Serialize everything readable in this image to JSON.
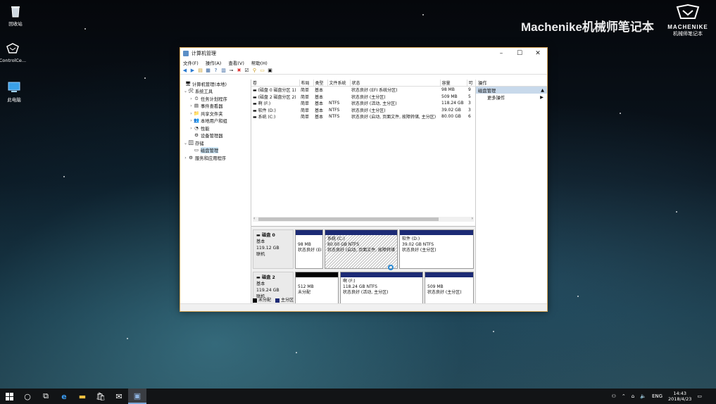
{
  "desktop": {
    "icons": [
      "回收站",
      "ControlCe...",
      "此电脑"
    ]
  },
  "watermark": {
    "text": "Machenike机械师笔记本",
    "brand_name": "MACHENIKE",
    "brand_sub": "机械师笔记本"
  },
  "window": {
    "title": "计算机管理",
    "min_glyph": "–",
    "max_glyph": "☐",
    "close_glyph": "✕",
    "menu": [
      "文件(F)",
      "操作(A)",
      "查看(V)",
      "帮助(H)"
    ],
    "tree": [
      {
        "label": "计算机管理(本地)",
        "arrow": "",
        "icon": "🖥"
      },
      {
        "label": "系统工具",
        "arrow": "⌄",
        "icon": "🛠"
      },
      {
        "label": "任务计划程序",
        "arrow": "›",
        "icon": "⏲"
      },
      {
        "label": "事件查看器",
        "arrow": "›",
        "icon": "▤"
      },
      {
        "label": "共享文件夹",
        "arrow": "›",
        "icon": "📁"
      },
      {
        "label": "本地用户和组",
        "arrow": "›",
        "icon": "👥"
      },
      {
        "label": "性能",
        "arrow": "›",
        "icon": "◔"
      },
      {
        "label": "设备管理器",
        "arrow": "",
        "icon": "⚙"
      },
      {
        "label": "存储",
        "arrow": "⌄",
        "icon": "🗄"
      },
      {
        "label": "磁盘管理",
        "arrow": "",
        "icon": "▭"
      },
      {
        "label": "服务和应用程序",
        "arrow": "›",
        "icon": "⚙"
      }
    ],
    "volume_columns": [
      "卷",
      "布局",
      "类型",
      "文件系统",
      "状态",
      "容量",
      "可"
    ],
    "volumes": [
      [
        "(磁盘 0 磁盘分区 1)",
        "简单",
        "基本",
        "",
        "状态良好 (EFI 系统分区)",
        "98 MB",
        "9"
      ],
      [
        "(磁盘 2 磁盘分区 2)",
        "简单",
        "基本",
        "",
        "状态良好 (主分区)",
        "509 MB",
        "5"
      ],
      [
        "啊 (F:)",
        "简单",
        "基本",
        "NTFS",
        "状态良好 (活动, 主分区)",
        "118.24 GB",
        "3"
      ],
      [
        "软件 (D:)",
        "简单",
        "基本",
        "NTFS",
        "状态良好 (主分区)",
        "39.02 GB",
        "3"
      ],
      [
        "系统 (C:)",
        "简单",
        "基本",
        "NTFS",
        "状态良好 (启动, 页面文件, 故障转储, 主分区)",
        "80.00 GB",
        "6"
      ]
    ],
    "disks": [
      {
        "name": "磁盘 0",
        "type": "基本",
        "size": "119.12 GB",
        "status": "联机",
        "partitions": [
          {
            "title": "",
            "size": "98 MB",
            "status": "状态良好 (EI"
          },
          {
            "title": "系统 (C:)",
            "size": "80.00 GB NTFS",
            "status": "状态良好 (启动, 页面文件, 故障转储"
          },
          {
            "title": "软件 (D:)",
            "size": "39.02 GB NTFS",
            "status": "状态良好 (主分区)"
          }
        ]
      },
      {
        "name": "磁盘 2",
        "type": "基本",
        "size": "119.24 GB",
        "status": "联机",
        "partitions": [
          {
            "title": "",
            "size": "512 MB",
            "status": "未分配"
          },
          {
            "title": "啊 (F:)",
            "size": "118.24 GB NTFS",
            "status": "状态良好 (活动, 主分区)"
          },
          {
            "title": "",
            "size": "509 MB",
            "status": "状态良好 (主分区)"
          }
        ]
      }
    ],
    "legend": [
      "未分配",
      "主分区"
    ],
    "actions": {
      "header": "操作",
      "section": "磁盘管理",
      "more": "更多操作"
    },
    "colors": {
      "primary_partition": "#1c2a75",
      "unallocated": "#000000",
      "selection": "#cde6f7"
    }
  },
  "taskbar": {
    "time": "14:43",
    "date": "2018/4/23",
    "lang": "ENG"
  }
}
